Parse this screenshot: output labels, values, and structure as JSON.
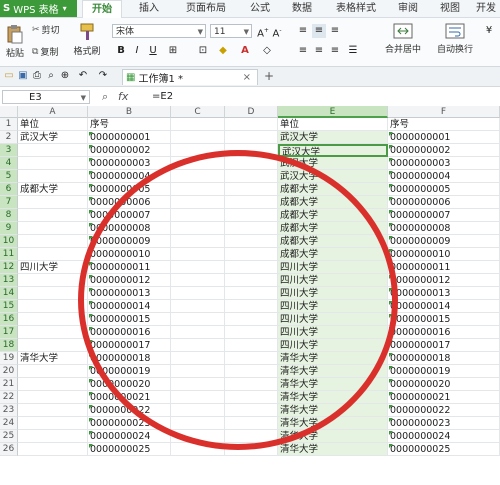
{
  "app": {
    "name": "WPS 表格",
    "logo": "S"
  },
  "menu_tabs": [
    "开始",
    "插入",
    "页面布局",
    "公式",
    "数据",
    "表格样式",
    "审阅",
    "视图",
    "开发"
  ],
  "ribbon": {
    "paste": "粘贴",
    "cut": "剪切",
    "copy": "复制",
    "format_painter": "格式刷",
    "font_name": "宋体",
    "font_size": "11",
    "merge_center": "合并居中",
    "wrap_text": "自动换行"
  },
  "document_tab": {
    "title": "工作簿1 *",
    "close": "×",
    "add": "+"
  },
  "formula_bar": {
    "cell_ref": "E3",
    "fx": "fx",
    "formula": "=E2"
  },
  "columns": [
    "A",
    "B",
    "C",
    "D",
    "E",
    "F"
  ],
  "rows": [
    "1",
    "2",
    "3",
    "4",
    "5",
    "6",
    "7",
    "8",
    "9",
    "10",
    "11",
    "12",
    "13",
    "14",
    "15",
    "16",
    "17",
    "18",
    "19",
    "20",
    "21",
    "22",
    "23",
    "24",
    "25",
    "26"
  ],
  "col_a": [
    "单位",
    "武汉大学",
    "",
    "",
    "",
    "成都大学",
    "",
    "",
    "",
    "",
    "",
    "四川大学",
    "",
    "",
    "",
    "",
    "",
    "",
    "清华大学",
    "",
    "",
    "",
    "",
    "",
    "",
    ""
  ],
  "col_b": [
    "序号",
    "0000000001",
    "0000000002",
    "0000000003",
    "0000000004",
    "0000000005",
    "0000000006",
    "0000000007",
    "0000000008",
    "0000000009",
    "0000000010",
    "0000000011",
    "0000000012",
    "0000000013",
    "0000000014",
    "0000000015",
    "0000000016",
    "0000000017",
    "0000000018",
    "0000000019",
    "0000000020",
    "0000000021",
    "0000000022",
    "0000000023",
    "0000000024",
    "0000000025"
  ],
  "col_e": [
    "单位",
    "武汉大学",
    "武汉大学",
    "武汉大学",
    "武汉大学",
    "成都大学",
    "成都大学",
    "成都大学",
    "成都大学",
    "成都大学",
    "成都大学",
    "四川大学",
    "四川大学",
    "四川大学",
    "四川大学",
    "四川大学",
    "四川大学",
    "四川大学",
    "清华大学",
    "清华大学",
    "清华大学",
    "清华大学",
    "清华大学",
    "清华大学",
    "清华大学",
    "清华大学"
  ],
  "col_f": [
    "序号",
    "0000000001",
    "0000000002",
    "0000000003",
    "0000000004",
    "0000000005",
    "0000000006",
    "0000000007",
    "0000000008",
    "0000000009",
    "0000000010",
    "0000000011",
    "0000000012",
    "0000000013",
    "0000000014",
    "0000000015",
    "0000000016",
    "0000000017",
    "0000000018",
    "0000000019",
    "0000000020",
    "0000000021",
    "0000000022",
    "0000000023",
    "0000000024",
    "0000000025"
  ]
}
